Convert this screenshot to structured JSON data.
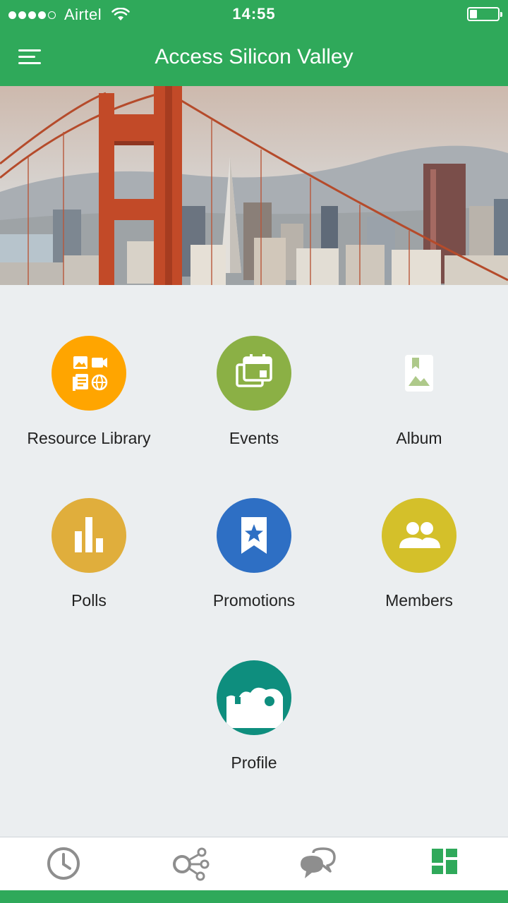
{
  "status_bar": {
    "carrier": "Airtel",
    "time": "14:55"
  },
  "app_bar": {
    "title": "Access Silicon Valley"
  },
  "colors": {
    "brand": "#2fa95a",
    "resource_library": "#ffa500",
    "events": "#8bb045",
    "album": "#aec98a",
    "polls": "#e0ae3c",
    "promotions": "#2e6fc4",
    "members": "#d4c02a",
    "profile": "#0e8e7e"
  },
  "tiles": [
    {
      "label": "Resource Library",
      "icon": "resource-library-icon"
    },
    {
      "label": "Events",
      "icon": "calendar-icon"
    },
    {
      "label": "Album",
      "icon": "photo-album-icon"
    },
    {
      "label": "Polls",
      "icon": "bar-chart-icon"
    },
    {
      "label": "Promotions",
      "icon": "bookmark-star-icon"
    },
    {
      "label": "Members",
      "icon": "people-icon"
    },
    {
      "label": "Profile",
      "icon": "face-icon"
    }
  ],
  "bottom_nav": [
    {
      "icon": "clock-icon",
      "active": false
    },
    {
      "icon": "share-network-icon",
      "active": false
    },
    {
      "icon": "chat-bubbles-icon",
      "active": false
    },
    {
      "icon": "dashboard-icon",
      "active": true
    }
  ]
}
